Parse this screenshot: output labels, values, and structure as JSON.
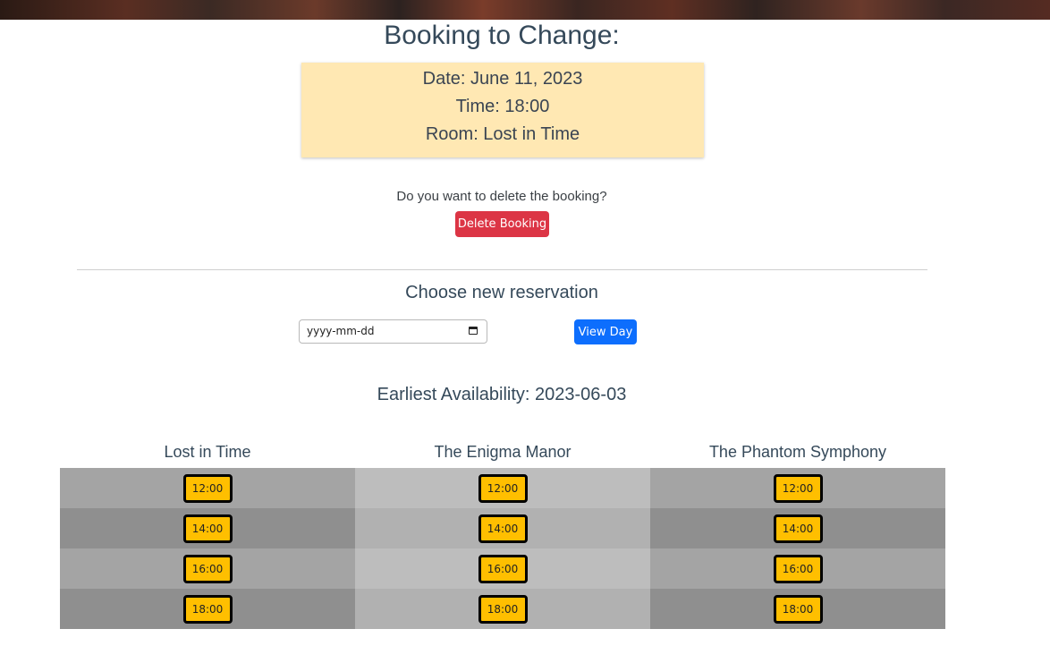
{
  "page": {
    "title": "Booking to Change:"
  },
  "booking": {
    "date": "Date: June 11, 2023",
    "time": "Time: 18:00",
    "room": "Room: Lost in Time"
  },
  "delete": {
    "question": "Do you want to delete the booking?",
    "button_label": "Delete Booking"
  },
  "reservation": {
    "section_title": "Choose new reservation",
    "date_placeholder": "yyyy-mm-dd",
    "view_day_label": "View Day"
  },
  "earliest": "Earliest Availability: 2023-06-03",
  "rooms": [
    {
      "name": "Lost in Time",
      "slots": [
        "12:00",
        "14:00",
        "16:00",
        "18:00"
      ]
    },
    {
      "name": "The Enigma Manor",
      "slots": [
        "12:00",
        "14:00",
        "16:00",
        "18:00"
      ]
    },
    {
      "name": "The Phantom Symphony",
      "slots": [
        "12:00",
        "14:00",
        "16:00",
        "18:00"
      ]
    }
  ],
  "colors": {
    "delete_button": "#dc3545",
    "view_day_button": "#0d6efd",
    "slot_button": "#ffbf00",
    "booking_card": "#ffe8b3"
  },
  "icons": {
    "date_input": "calendar-icon"
  }
}
